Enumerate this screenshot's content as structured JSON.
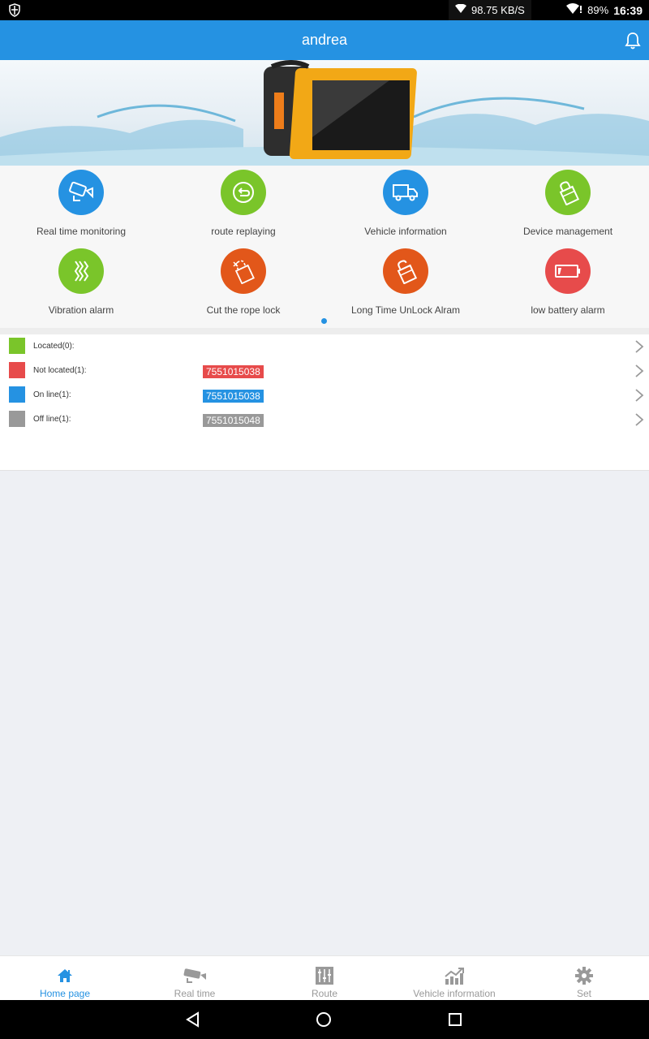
{
  "status_bar": {
    "net_speed": "98.75 KB/S",
    "battery": "89%",
    "time": "16:39",
    "icons": [
      "shield-icon",
      "wifi-icon",
      "wifi-alert-icon"
    ]
  },
  "app_bar": {
    "title": "andrea",
    "action_icon": "bell-icon"
  },
  "banner": {
    "description": "Solar GPS tracker device splashing in water"
  },
  "features": [
    {
      "label": "Real time monitoring",
      "icon": "camera-icon",
      "color": "#2592e2"
    },
    {
      "label": "route replaying",
      "icon": "replay-icon",
      "color": "#7ac52a"
    },
    {
      "label": "Vehicle information",
      "icon": "truck-icon",
      "color": "#2592e2"
    },
    {
      "label": "Device management",
      "icon": "padlock-icon",
      "color": "#7ac52a"
    },
    {
      "label": "Vibration alarm",
      "icon": "vibration-icon",
      "color": "#7ac52a"
    },
    {
      "label": "Cut the rope lock",
      "icon": "cut-lock-icon",
      "color": "#e2571a"
    },
    {
      "label": "Long Time UnLock Alram",
      "icon": "unlock-icon",
      "color": "#e2571a"
    },
    {
      "label": "low battery alarm",
      "icon": "low-battery-icon",
      "color": "#e74b4b"
    }
  ],
  "pager": {
    "pages": 1,
    "current": 1
  },
  "status_list": [
    {
      "label": "Located(0):",
      "color": "#7ac52a",
      "devices": []
    },
    {
      "label": "Not located(1):",
      "color": "#e74b4b",
      "devices": [
        "7551015038"
      ]
    },
    {
      "label": "On line(1):",
      "color": "#2592e2",
      "devices": [
        "7551015038"
      ]
    },
    {
      "label": "Off line(1):",
      "color": "#999999",
      "devices": [
        "7551015048"
      ]
    }
  ],
  "bottom_nav": [
    {
      "label": "Home page",
      "icon": "home-icon",
      "active": true
    },
    {
      "label": "Real time",
      "icon": "cctv-camera-icon",
      "active": false
    },
    {
      "label": "Route",
      "icon": "sliders-icon",
      "active": false
    },
    {
      "label": "Vehicle information",
      "icon": "chart-up-icon",
      "active": false
    },
    {
      "label": "Set",
      "icon": "gear-icon",
      "active": false
    }
  ],
  "colors": {
    "primary": "#2592e2",
    "green": "#7ac52a",
    "orange": "#e2571a",
    "red": "#e74b4b",
    "gray": "#999999"
  }
}
